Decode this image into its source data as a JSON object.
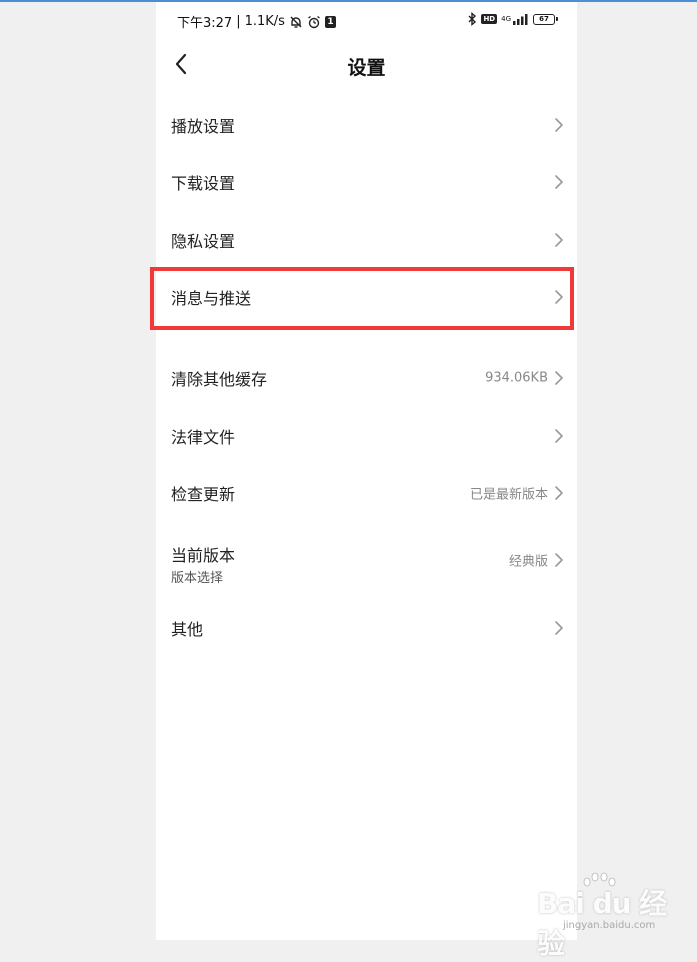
{
  "status_bar": {
    "time": "下午3:27",
    "speed": "1.1K/s",
    "sim_badge": "1",
    "hd": "HD",
    "network": "4G",
    "battery": "67"
  },
  "header": {
    "title": "设置",
    "back_icon": "chevron-left-icon"
  },
  "rows": [
    {
      "label": "播放设置",
      "value": "",
      "sub": ""
    },
    {
      "label": "下载设置",
      "value": "",
      "sub": ""
    },
    {
      "label": "隐私设置",
      "value": "",
      "sub": ""
    },
    {
      "label": "消息与推送",
      "value": "",
      "sub": "",
      "highlighted": true
    },
    {
      "label": "清除其他缓存",
      "value": "934.06KB",
      "sub": ""
    },
    {
      "label": "法律文件",
      "value": "",
      "sub": ""
    },
    {
      "label": "检查更新",
      "value": "已是最新版本",
      "sub": ""
    },
    {
      "label": "当前版本",
      "value": "经典版",
      "sub": "版本选择"
    },
    {
      "label": "其他",
      "value": "",
      "sub": ""
    }
  ],
  "colors": {
    "highlight_border": "#f03a3a",
    "page_bg": "#f0f0f0"
  },
  "watermark": {
    "logo": "Bai du 经验",
    "site": "jingyan.baidu.com"
  }
}
